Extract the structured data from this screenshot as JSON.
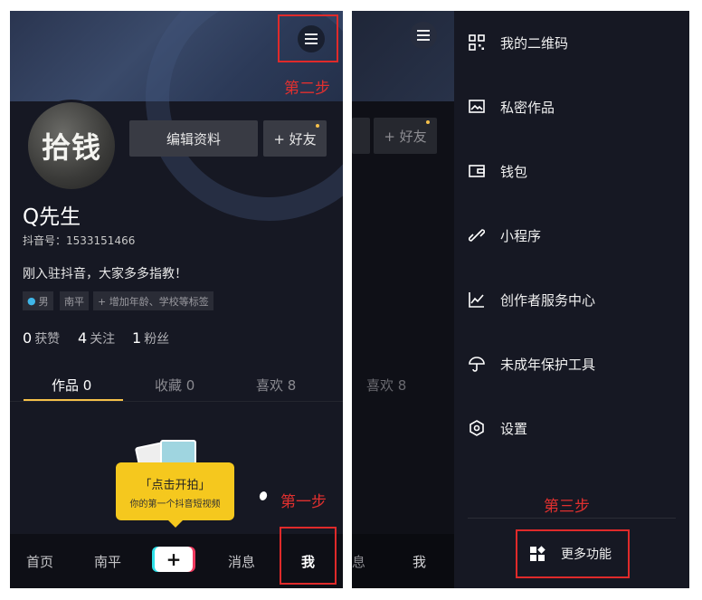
{
  "left": {
    "avatar_text": "拾钱",
    "edit_profile": "编辑资料",
    "add_friend": "+ 好友",
    "username": "Q先生",
    "douyin_id": "抖音号：1533151466",
    "bio": "刚入驻抖音，大家多多指教！",
    "tags": [
      "男",
      "南平",
      "+ 增加年龄、学校等标签"
    ],
    "stats": [
      {
        "value": "0",
        "label": "获赞"
      },
      {
        "value": "4",
        "label": "关注"
      },
      {
        "value": "1",
        "label": "粉丝"
      }
    ],
    "tabs": [
      {
        "label": "作品 0"
      },
      {
        "label": "收藏 0"
      },
      {
        "label": "喜欢 8"
      }
    ],
    "bubble_title": "「点击开拍」",
    "bubble_sub": "你的第一个抖音短视频",
    "nav": [
      {
        "label": "首页"
      },
      {
        "label": "南平"
      },
      {
        "label": "+"
      },
      {
        "label": "消息"
      },
      {
        "label": "我"
      }
    ],
    "step1": "第一步",
    "step2": "第二步"
  },
  "right": {
    "bg_add_friend": "+ 好友",
    "bg_like_tab": "喜欢 8",
    "bg_nav_msg": "息",
    "bg_nav_me": "我",
    "menu": [
      {
        "label": "我的二维码",
        "icon": "qrcode-icon"
      },
      {
        "label": "私密作品",
        "icon": "private-image-icon"
      },
      {
        "label": "钱包",
        "icon": "wallet-icon"
      },
      {
        "label": "小程序",
        "icon": "mini-program-icon"
      },
      {
        "label": "创作者服务中心",
        "icon": "chart-line-icon"
      },
      {
        "label": "未成年保护工具",
        "icon": "umbrella-icon"
      },
      {
        "label": "设置",
        "icon": "settings-icon"
      }
    ],
    "more": "更多功能",
    "step3": "第三步"
  },
  "colors": {
    "annotation": "#e02a2a",
    "accent": "#f5c04a",
    "background": "#161823"
  }
}
